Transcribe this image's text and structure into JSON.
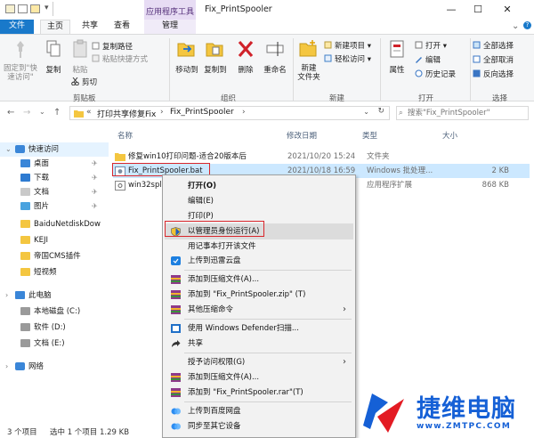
{
  "window": {
    "title": "Fix_PrintSpooler",
    "context_tab_group": "应用程序工具",
    "minimize": "—",
    "maximize": "☐",
    "close": "✕"
  },
  "tabs": {
    "file": "文件",
    "home": "主页",
    "share": "共享",
    "view": "查看",
    "manage": "管理"
  },
  "ribbon": {
    "clipboard": {
      "group_label": "剪贴板",
      "pin_quick_access": "固定到\"快\n速访问\"",
      "copy": "复制",
      "paste": "粘贴",
      "copy_path": "复制路径",
      "paste_shortcut": "粘贴快捷方式",
      "cut": "剪切"
    },
    "organize": {
      "group_label": "组织",
      "move_to": "移动到",
      "copy_to": "复制到",
      "delete": "删除",
      "rename": "重命名"
    },
    "new": {
      "group_label": "新建",
      "new_folder": "新建\n文件夹",
      "new_item": "新建项目 ▾",
      "easy_access": "轻松访问 ▾"
    },
    "open": {
      "group_label": "打开",
      "properties": "属性",
      "open": "打开 ▾",
      "edit": "编辑",
      "history": "历史记录"
    },
    "select": {
      "group_label": "选择",
      "select_all": "全部选择",
      "select_none": "全部取消",
      "invert": "反向选择"
    }
  },
  "address": {
    "crumb_1": "打印共享修复Fix",
    "crumb_2": "Fix_PrintSpooler",
    "search_placeholder": "搜索\"Fix_PrintSpooler\""
  },
  "nav": {
    "items": [
      {
        "label": "快速访问",
        "pinned": false
      },
      {
        "label": "桌面",
        "pinned": true
      },
      {
        "label": "下载",
        "pinned": true
      },
      {
        "label": "文档",
        "pinned": true
      },
      {
        "label": "图片",
        "pinned": true
      },
      {
        "label": "BaiduNetdiskDow",
        "pinned": false
      },
      {
        "label": "KEJI",
        "pinned": false
      },
      {
        "label": "帝国CMS插件",
        "pinned": false
      },
      {
        "label": "短视频",
        "pinned": false
      },
      {
        "label": "此电脑",
        "pinned": false
      },
      {
        "label": "本地磁盘 (C:)",
        "pinned": false
      },
      {
        "label": "软件 (D:)",
        "pinned": false
      },
      {
        "label": "文档 (E:)",
        "pinned": false
      },
      {
        "label": "网络",
        "pinned": false
      }
    ],
    "pin_glyph": "✈"
  },
  "files": {
    "headers": {
      "name": "名称",
      "date": "修改日期",
      "type": "类型",
      "size": "大小"
    },
    "rows": [
      {
        "name": "修复win10打印问题-适合20版本后",
        "date": "2021/10/20 15:24",
        "type": "文件夹",
        "size": ""
      },
      {
        "name": "Fix_PrintSpooler.bat",
        "date": "2021/10/18 16:59",
        "type": "Windows 批处理...",
        "size": "2 KB"
      },
      {
        "name": "win32spl...",
        "date": "",
        "type": "应用程序扩展",
        "size": "868 KB"
      }
    ]
  },
  "context_menu": {
    "open": "打开(O)",
    "edit": "编辑(E)",
    "print": "打印(P)",
    "run_as_admin": "以管理员身份运行(A)",
    "notepad": "用记事本打开该文件",
    "upload_xunlei": "上传到迅雷云盘",
    "add_archive": "添加到压缩文件(A)...",
    "add_zip": "添加到 \"Fix_PrintSpooler.zip\" (T)",
    "other_compress": "其他压缩命令",
    "defender": "使用 Windows Defender扫描...",
    "share": "共享",
    "grant_access": "授予访问权限(G)",
    "add_archive_2": "添加到压缩文件(A)...",
    "add_rar": "添加到 \"Fix_PrintSpooler.rar\"(T)",
    "upload_baidu": "上传到百度网盘",
    "sync_device": "同步至其它设备"
  },
  "status": {
    "count": "3 个项目",
    "selected": "选中 1 个项目  1.29 KB"
  },
  "watermark": {
    "text": "捷维电脑",
    "url": "www.ZMTPC.COM"
  },
  "colors": {
    "file_tab": "#1979ca",
    "context_tab": "#e7dcf4",
    "highlight": "#cce8ff",
    "red_outline": "#d9262b",
    "watermark": "#1560d6"
  }
}
